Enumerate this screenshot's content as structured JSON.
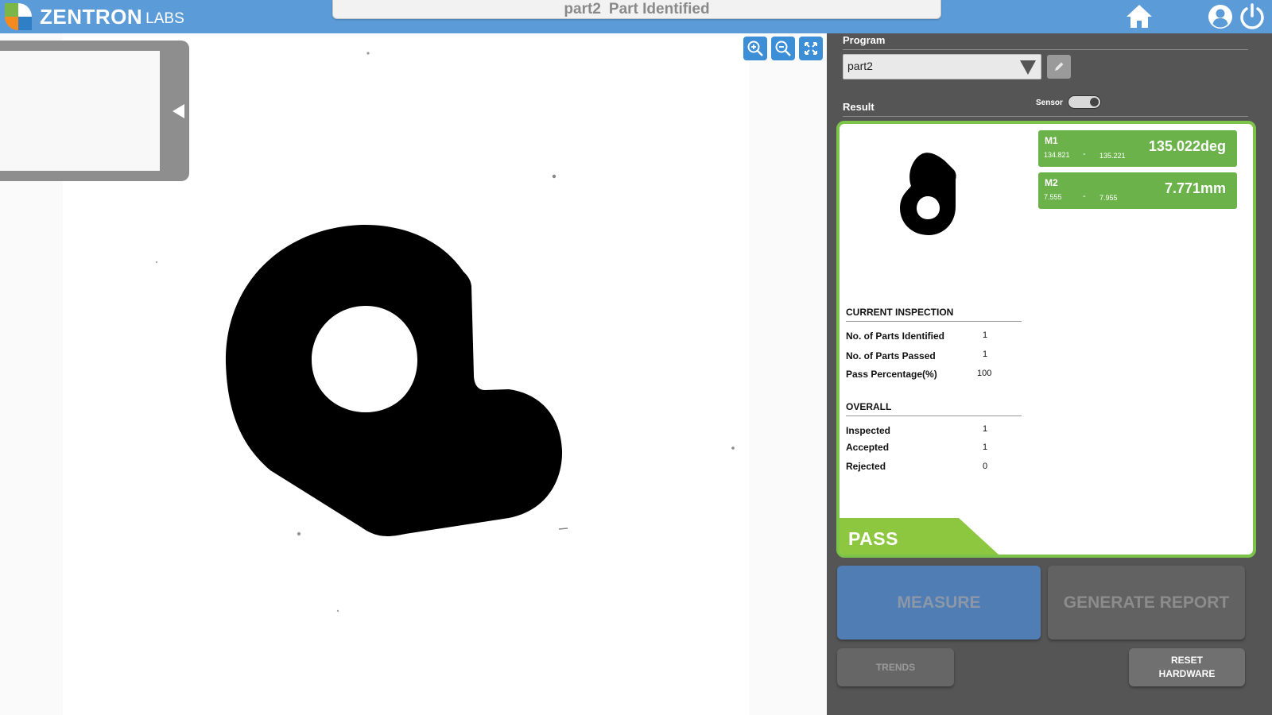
{
  "app": {
    "brand_name": "ZENTRON",
    "brand_sub": "LABS",
    "title_program": "part2",
    "title_status": "Part Identified"
  },
  "icons": {
    "home": "home-icon",
    "user": "user-icon",
    "power": "power-icon",
    "zoom_in": "zoom-in-icon",
    "zoom_out": "zoom-out-icon",
    "fit": "fit-screen-icon",
    "edit": "pencil-icon"
  },
  "panel": {
    "program_label": "Program",
    "program_value": "part2",
    "result_label": "Result",
    "sensor_label": "Sensor"
  },
  "measurements": [
    {
      "name": "M1",
      "lower": "134.821",
      "sep": "-",
      "upper": "135.221",
      "value": "135.022deg"
    },
    {
      "name": "M2",
      "lower": "7.555",
      "sep": "-",
      "upper": "7.955",
      "value": "7.771mm"
    }
  ],
  "current_inspection": {
    "heading": "CURRENT INSPECTION",
    "rows": [
      {
        "label": "No. of Parts Identified",
        "value": "1"
      },
      {
        "label": "No. of Parts Passed",
        "value": "1"
      },
      {
        "label": "Pass Percentage(%)",
        "value": "100"
      }
    ]
  },
  "overall": {
    "heading": "OVERALL",
    "rows": [
      {
        "label": "Inspected",
        "value": "1"
      },
      {
        "label": "Accepted",
        "value": "1"
      },
      {
        "label": "Rejected",
        "value": "0"
      }
    ]
  },
  "result_status": "PASS",
  "buttons": {
    "measure": "MEASURE",
    "generate_report": "GENERATE REPORT",
    "trends": "TRENDS",
    "reset_line1": "RESET",
    "reset_line2": "HARDWARE"
  },
  "colors": {
    "topbar": "#5b9bd8",
    "panel_bg": "#555555",
    "pass_green": "#7cc34a",
    "measure_green": "#6bb24a",
    "measure_button": "#4f7db4"
  }
}
